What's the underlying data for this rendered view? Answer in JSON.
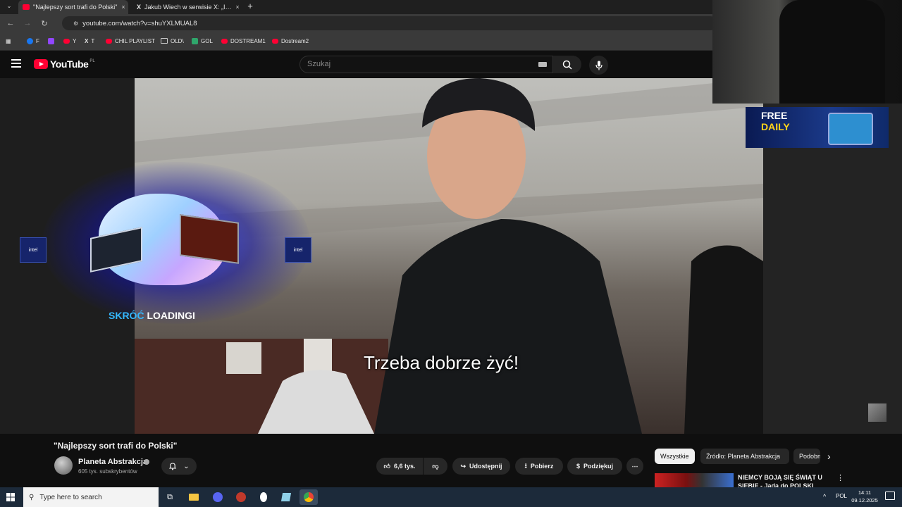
{
  "browser": {
    "tabs": [
      {
        "title": "\"Najlepszy sort trafi do Polski\"",
        "active": true
      },
      {
        "title": "Jakub Wiech w serwisie X: „I teraz",
        "active": false
      }
    ],
    "new_tab_symbol": "+",
    "close_symbol": "×",
    "url": "youtube.com/watch?v=shuYXLMUAL8",
    "bookmarks": [
      {
        "label": "F",
        "color": "#1877f2"
      },
      {
        "label": "",
        "color": "#9146ff"
      },
      {
        "label": "Y",
        "color": "#ff0033"
      },
      {
        "label": "T",
        "color": "#000000"
      },
      {
        "label": "CHIL PLAYLIST",
        "color": "#ff0033"
      },
      {
        "label": "OLD\\",
        "color": "#cccccc"
      },
      {
        "label": "GOL",
        "color": "#2fa66b"
      },
      {
        "label": "DOSTREAM1",
        "color": "#ff0033"
      },
      {
        "label": "Dostream2",
        "color": "#ff0033"
      }
    ]
  },
  "youtube": {
    "logo_text": "YouTube",
    "region": "PL",
    "search_placeholder": "Szukaj"
  },
  "video": {
    "subtitle": "Trzeba dobrze żyć!",
    "ad_text_accent": "SKRÓĆ",
    "ad_text_rest": " LOADINGI",
    "intel_label": "intel",
    "promo_line1": "FREE",
    "promo_line2": "DAILY",
    "title": "\"Najlepszy sort trafi do Polski\""
  },
  "channel": {
    "name": "Planeta Abstrakcja",
    "subscribers": "605 tys. subskrybentów"
  },
  "actions": {
    "likes": "6,6 tys.",
    "share": "Udostępnij",
    "download": "Pobierz",
    "thanks": "Podziękuj",
    "more": "⋯"
  },
  "chips": [
    "Wszystkie",
    "Źródło: Planeta Abstrakcja",
    "Podobne"
  ],
  "recommendation": {
    "title": "NIEMCY BOJĄ SIĘ ŚWIĄT U SIEBIE - Jadą do POLSKI"
  },
  "taskbar": {
    "search_placeholder": "Type here to search",
    "language": "POL",
    "time": "14:11",
    "date": "09.12.2025"
  },
  "colors": {
    "accent_red": "#ff0033",
    "background": "#0f0f0f",
    "taskbar": "#1c2a3a"
  }
}
